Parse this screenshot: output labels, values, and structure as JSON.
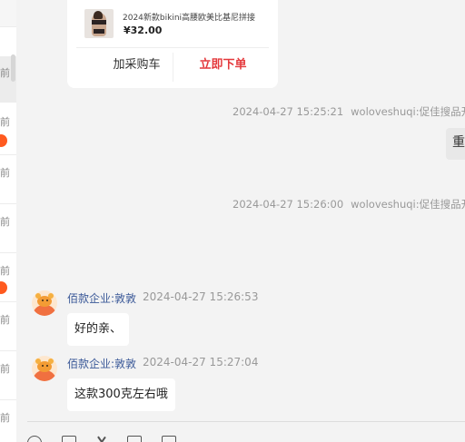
{
  "sidebar": {
    "items": [
      {
        "time": "前",
        "active": true,
        "badge": false
      },
      {
        "time": "前",
        "active": false,
        "badge": true
      },
      {
        "time": "前",
        "active": false,
        "badge": false
      },
      {
        "time": "前",
        "active": false,
        "badge": false
      },
      {
        "time": "前",
        "active": false,
        "badge": true
      },
      {
        "time": "前",
        "active": false,
        "badge": false
      },
      {
        "time": "前",
        "active": false,
        "badge": false
      },
      {
        "time": "前",
        "active": false,
        "badge": false
      }
    ]
  },
  "product_card": {
    "title": "2024新款bikini高腰欧美比基尼拼接",
    "price": "¥32.00",
    "cart_label": "加采购车",
    "buy_label": "立即下单"
  },
  "system_messages": [
    {
      "time": "2024-04-27 15:25:21",
      "text": "woloveshuqi:促佳搜品开"
    },
    {
      "time": "2024-04-27 15:26:00",
      "text": "woloveshuqi:促佳搜品开"
    }
  ],
  "right_bubble": {
    "text": "重"
  },
  "messages": [
    {
      "sender": "佰款企业:敦敦",
      "time": "2024-04-27 15:26:53",
      "text": "好的亲、"
    },
    {
      "sender": "佰款企业:敦敦",
      "time": "2024-04-27 15:27:04",
      "text": "这款300克左右哦"
    }
  ],
  "toolbar": {
    "icons": [
      "emoji-icon",
      "folder-icon",
      "scissors-icon",
      "doc-icon",
      "image-icon"
    ]
  },
  "colors": {
    "accent_red": "#e4393c",
    "badge_orange": "#ff5a1f",
    "link_blue": "#3b5998"
  }
}
